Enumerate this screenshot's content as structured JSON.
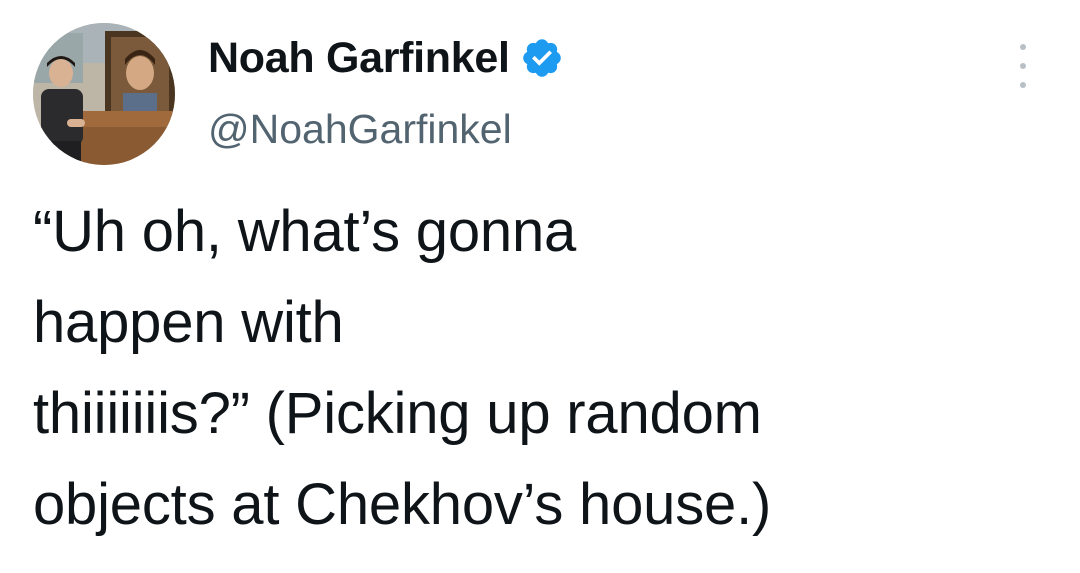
{
  "author": {
    "display_name": "Noah Garfinkel",
    "handle": "@NoahGarfinkel",
    "verified": true,
    "verified_color": "#1d9bf0"
  },
  "avatar": {
    "alt": "profile photo"
  },
  "menu": {
    "icon": "more-options-icon"
  },
  "tweet": {
    "lines": [
      "“Uh oh, what’s gonna",
      "happen with",
      "thiiiiiiis?” (Picking up random",
      "objects at Chekhov’s house.)"
    ]
  },
  "colors": {
    "text": "#0f1419",
    "secondary_text": "#536471",
    "background": "#ffffff"
  }
}
